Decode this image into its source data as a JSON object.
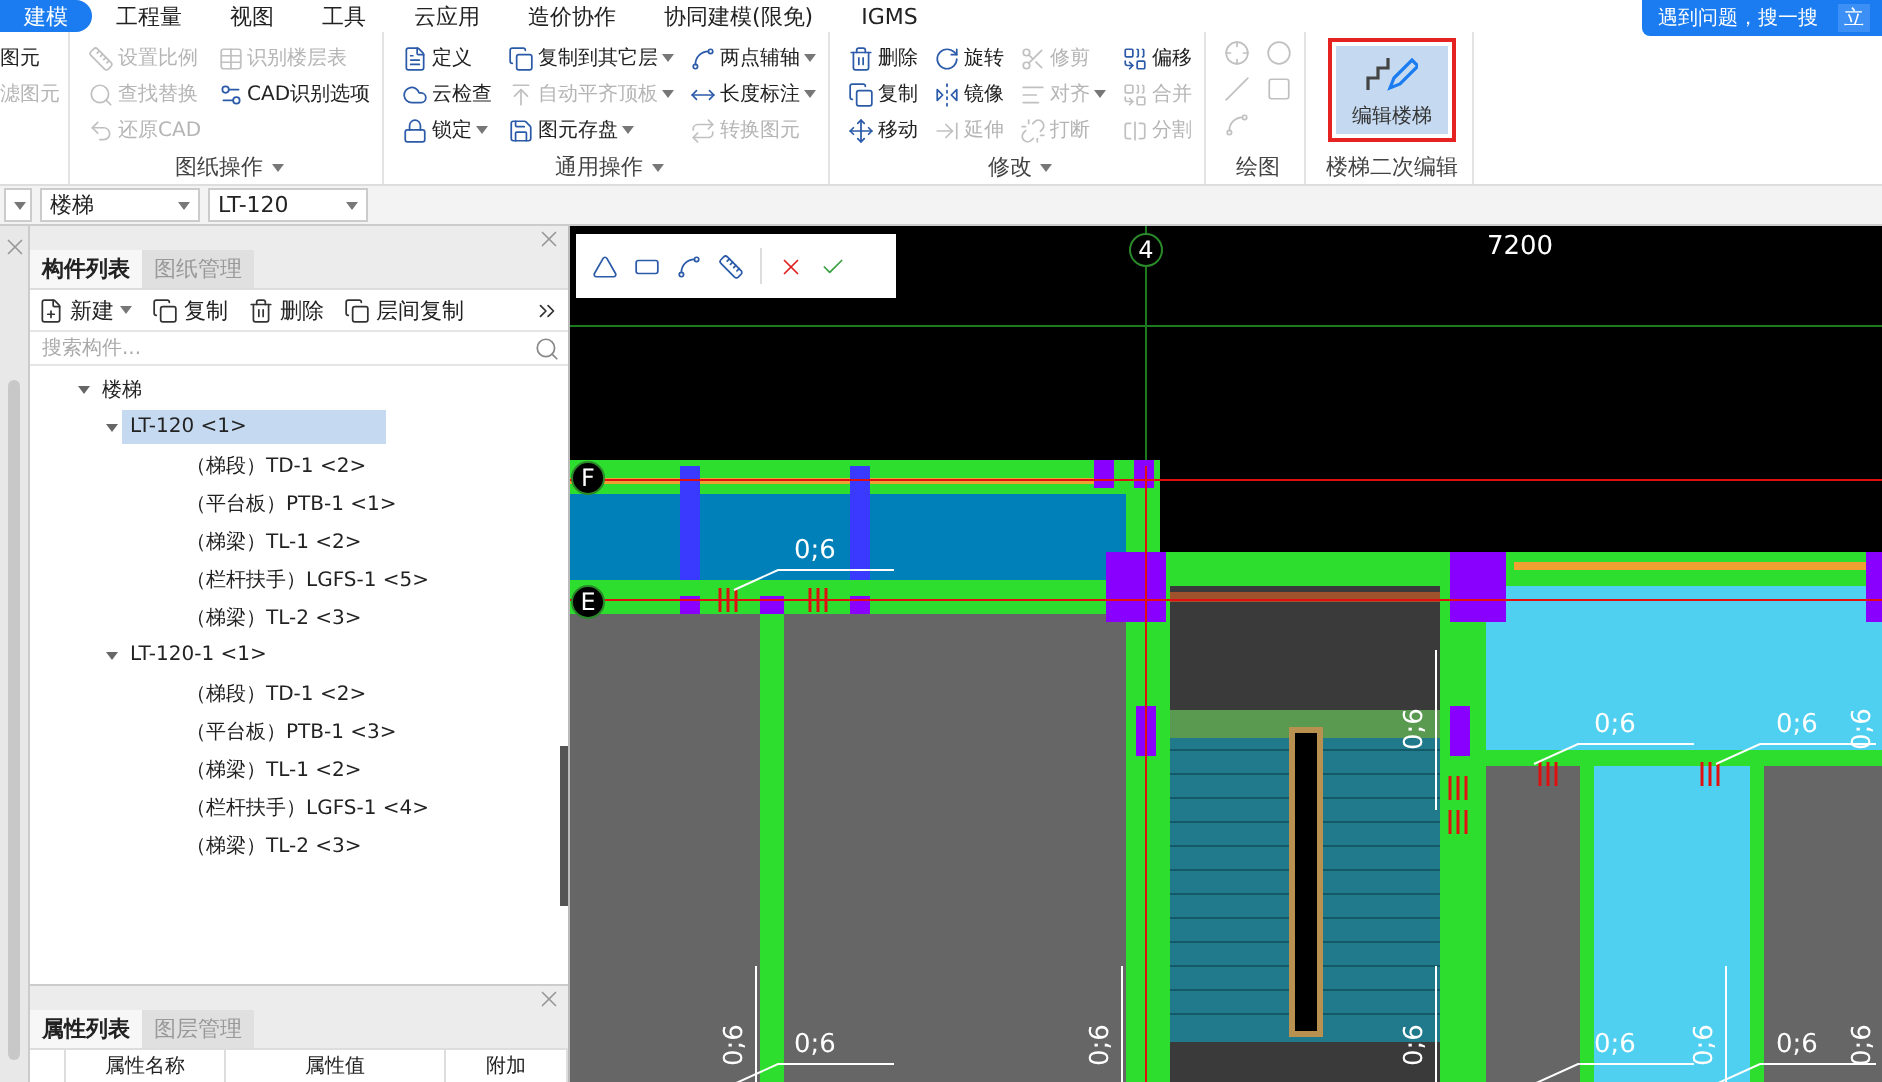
{
  "tabs": [
    {
      "label": "建模",
      "selected": true
    },
    {
      "label": "工程量",
      "selected": false
    },
    {
      "label": "视图",
      "selected": false
    },
    {
      "label": "工具",
      "selected": false
    },
    {
      "label": "云应用",
      "selected": false
    },
    {
      "label": "造价协作",
      "selected": false
    },
    {
      "label": "协同建模(限免)",
      "selected": false
    },
    {
      "label": "IGMS",
      "selected": false
    }
  ],
  "help_search": "遇到问题，搜一搜",
  "help_button": "立",
  "ribbon": {
    "partial_items": [
      "图元",
      "滤图元"
    ],
    "groups": [
      {
        "title": "图纸操作",
        "menu": true,
        "items": [
          {
            "label": "设置比例",
            "disabled": true,
            "dropdown": false
          },
          {
            "label": "查找替换",
            "disabled": true,
            "dropdown": false
          },
          {
            "label": "还原CAD",
            "disabled": true,
            "dropdown": false
          },
          {
            "label": "识别楼层表",
            "disabled": true,
            "dropdown": false
          },
          {
            "label": "CAD识别选项",
            "disabled": false,
            "dropdown": false
          }
        ]
      },
      {
        "title": "通用操作",
        "menu": true,
        "items": [
          {
            "label": "定义",
            "disabled": false,
            "dropdown": false
          },
          {
            "label": "云检查",
            "disabled": false,
            "dropdown": false
          },
          {
            "label": "锁定",
            "disabled": false,
            "dropdown": true
          },
          {
            "label": "复制到其它层",
            "disabled": false,
            "dropdown": true
          },
          {
            "label": "自动平齐顶板",
            "disabled": true,
            "dropdown": true
          },
          {
            "label": "图元存盘",
            "disabled": false,
            "dropdown": true
          },
          {
            "label": "两点辅轴",
            "disabled": false,
            "dropdown": true
          },
          {
            "label": "长度标注",
            "disabled": false,
            "dropdown": true
          },
          {
            "label": "转换图元",
            "disabled": true,
            "dropdown": false
          }
        ]
      },
      {
        "title": "修改",
        "menu": true,
        "items": [
          {
            "label": "删除",
            "disabled": false,
            "dropdown": false
          },
          {
            "label": "复制",
            "disabled": false,
            "dropdown": false
          },
          {
            "label": "移动",
            "disabled": false,
            "dropdown": false
          },
          {
            "label": "旋转",
            "disabled": false,
            "dropdown": false
          },
          {
            "label": "镜像",
            "disabled": false,
            "dropdown": false
          },
          {
            "label": "延伸",
            "disabled": true,
            "dropdown": false
          },
          {
            "label": "修剪",
            "disabled": true,
            "dropdown": false
          },
          {
            "label": "对齐",
            "disabled": true,
            "dropdown": true
          },
          {
            "label": "打断",
            "disabled": true,
            "dropdown": false
          },
          {
            "label": "偏移",
            "disabled": false,
            "dropdown": false
          },
          {
            "label": "合并",
            "disabled": true,
            "dropdown": false
          },
          {
            "label": "分割",
            "disabled": true,
            "dropdown": false
          }
        ]
      }
    ],
    "draw_group": {
      "title": "绘图"
    },
    "stair_group": {
      "title": "楼梯二次编辑",
      "button": {
        "label": "编辑楼梯",
        "selected": true,
        "highlighted": true
      }
    }
  },
  "selectors": [
    "楼梯",
    "LT-120"
  ],
  "component_panel": {
    "tabs": [
      {
        "label": "构件列表",
        "selected": true
      },
      {
        "label": "图纸管理",
        "selected": false
      }
    ],
    "actions": [
      {
        "label": "新建",
        "dropdown": true
      },
      {
        "label": "复制",
        "dropdown": false
      },
      {
        "label": "删除",
        "dropdown": false
      },
      {
        "label": "层间复制",
        "dropdown": false
      }
    ],
    "search": {
      "placeholder": "搜索构件..."
    },
    "tree": [
      {
        "label": "楼梯",
        "expanded": true,
        "selected": false,
        "children": [
          {
            "label": "LT-120 <1>",
            "expanded": true,
            "selected": true,
            "children": [
              {
                "label": "（梯段）TD-1 <2>",
                "selected": false
              },
              {
                "label": "（平台板）PTB-1 <1>",
                "selected": false
              },
              {
                "label": "（梯梁）TL-1 <2>",
                "selected": false
              },
              {
                "label": "（栏杆扶手）LGFS-1 <5>",
                "selected": false
              },
              {
                "label": "（梯梁）TL-2 <3>",
                "selected": false
              }
            ]
          },
          {
            "label": "LT-120-1 <1>",
            "expanded": true,
            "selected": false,
            "children": [
              {
                "label": "（梯段）TD-1 <2>",
                "selected": false
              },
              {
                "label": "（平台板）PTB-1 <3>",
                "selected": false
              },
              {
                "label": "（梯梁）TL-1 <2>",
                "selected": false
              },
              {
                "label": "（栏杆扶手）LGFS-1 <4>",
                "selected": false
              },
              {
                "label": "（梯梁）TL-2 <3>",
                "selected": false
              }
            ]
          }
        ]
      }
    ]
  },
  "property_panel": {
    "tabs": [
      {
        "label": "属性列表",
        "selected": true
      },
      {
        "label": "图层管理",
        "selected": false
      }
    ],
    "columns": [
      "属性名称",
      "属性值",
      "附加"
    ]
  },
  "canvas": {
    "axis_labels": [
      "4",
      "F",
      "E"
    ],
    "dimension": "7200",
    "annotations": [
      {
        "text": "0;6",
        "kind": "horizontal"
      },
      {
        "text": "0;6",
        "kind": "horizontal"
      },
      {
        "text": "0;6",
        "kind": "horizontal"
      },
      {
        "text": "0;6",
        "kind": "horizontal"
      },
      {
        "text": "0;6",
        "kind": "horizontal"
      },
      {
        "text": "0;6",
        "kind": "horizontal"
      },
      {
        "text": "0;6",
        "kind": "vertical"
      },
      {
        "text": "0;6",
        "kind": "vertical"
      },
      {
        "text": "0;6",
        "kind": "vertical"
      },
      {
        "text": "0;6",
        "kind": "vertical"
      },
      {
        "text": "0;6",
        "kind": "vertical"
      },
      {
        "text": "0;6",
        "kind": "vertical"
      },
      {
        "text": "0;6",
        "kind": "vertical"
      }
    ]
  }
}
